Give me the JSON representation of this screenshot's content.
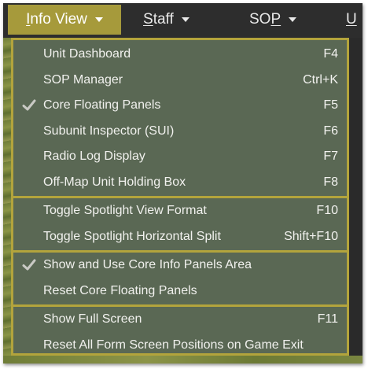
{
  "menubar": {
    "items": [
      {
        "label": "Info View",
        "underline": "I",
        "rest": "nfo View",
        "active": true
      },
      {
        "label": "Staff",
        "underline": "S",
        "rest": "taff"
      },
      {
        "label": "SOP",
        "pre": "SO",
        "underline": "P"
      },
      {
        "label": "U",
        "underline": "U"
      }
    ]
  },
  "dropdown": {
    "groups": [
      {
        "items": [
          {
            "label": "Unit Dashboard",
            "shortcut": "F4",
            "checked": false
          },
          {
            "label": "SOP Manager",
            "shortcut": "Ctrl+K",
            "checked": false
          },
          {
            "label": "Core Floating Panels",
            "shortcut": "F5",
            "checked": true
          },
          {
            "label": "Subunit Inspector (SUI)",
            "shortcut": "F6",
            "checked": false
          },
          {
            "label": "Radio Log Display",
            "shortcut": "F7",
            "checked": false
          },
          {
            "label": "Off-Map Unit Holding Box",
            "shortcut": "F8",
            "checked": false
          }
        ]
      },
      {
        "items": [
          {
            "label": "Toggle Spotlight View Format",
            "shortcut": "F10",
            "checked": false
          },
          {
            "label": "Toggle Spotlight Horizontal Split",
            "shortcut": "Shift+F10",
            "checked": false
          }
        ]
      },
      {
        "items": [
          {
            "label": "Show and Use Core Info Panels Area",
            "shortcut": "",
            "checked": true
          },
          {
            "label": "Reset Core Floating Panels",
            "shortcut": "",
            "checked": false
          }
        ]
      },
      {
        "items": [
          {
            "label": "Show Full Screen",
            "shortcut": "F11",
            "checked": false
          },
          {
            "label": "Reset All Form Screen Positions on Game Exit",
            "shortcut": "",
            "checked": false
          }
        ]
      }
    ]
  },
  "colors": {
    "menu_bg": "#5a6854",
    "accent_border": "#b3a43c",
    "active_tab": "#a69a3b",
    "menubar_bg": "#2d2d2d",
    "text": "#f1f1ee"
  },
  "icons": {
    "check": "check-icon",
    "caret": "caret-down-icon"
  }
}
